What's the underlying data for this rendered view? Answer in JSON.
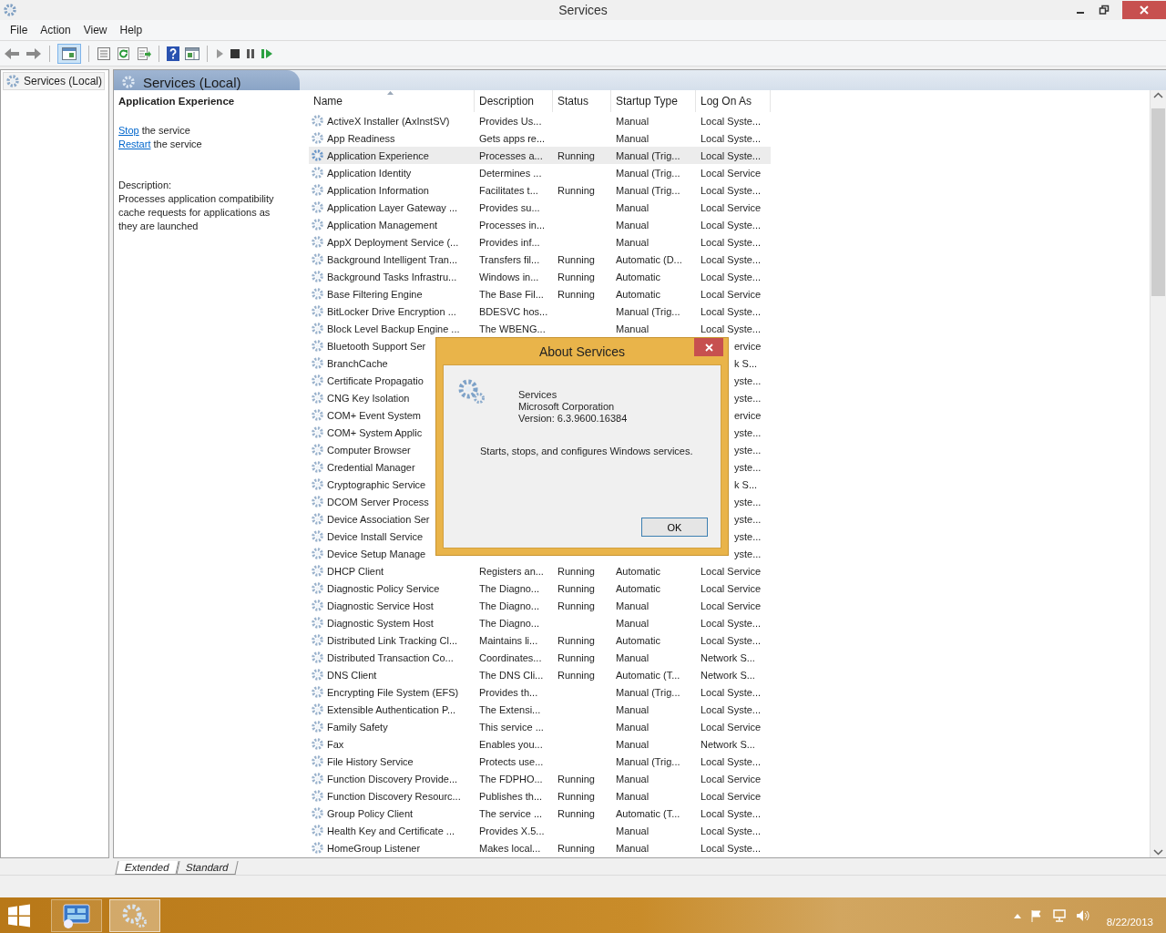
{
  "window": {
    "title": "Services"
  },
  "menu": [
    "File",
    "Action",
    "View",
    "Help"
  ],
  "tree": [
    {
      "label": "Services (Local)",
      "selected": true
    }
  ],
  "pane_header": "Services (Local)",
  "details": {
    "title": "Application Experience",
    "actions": [
      {
        "link": "Stop",
        "text": "the service"
      },
      {
        "link": "Restart",
        "text": "the service"
      }
    ],
    "description_label": "Description:",
    "description": "Processes application compatibility cache requests for applications as they are launched"
  },
  "table": {
    "columns": [
      "Name",
      "Description",
      "Status",
      "Startup Type",
      "Log On As"
    ],
    "rows": [
      {
        "kind": "service",
        "selected": false,
        "name": "ActiveX Installer (AxInstSV)",
        "description": "Provides Us...",
        "startup": "Manual",
        "logon": "Local Syste..."
      },
      {
        "kind": "service",
        "selected": false,
        "name": "App Readiness",
        "description": "Gets apps re...",
        "startup": "Manual",
        "logon": "Local Syste..."
      },
      {
        "kind": "service",
        "selected": true,
        "name": "Application Experience",
        "description": "Processes a...",
        "status": "Running",
        "startup": "Manual (Trig...",
        "logon": "Local Syste..."
      },
      {
        "kind": "service",
        "selected": false,
        "name": "Application Identity",
        "description": "Determines ...",
        "startup": "Manual (Trig...",
        "logon": "Local Service"
      },
      {
        "kind": "service",
        "selected": false,
        "name": "Application Information",
        "description": "Facilitates t...",
        "status": "Running",
        "startup": "Manual (Trig...",
        "logon": "Local Syste..."
      },
      {
        "kind": "service",
        "selected": false,
        "name": "Application Layer Gateway ...",
        "description": "Provides su...",
        "startup": "Manual",
        "logon": "Local Service"
      },
      {
        "kind": "service",
        "selected": false,
        "name": "Application Management",
        "description": "Processes in...",
        "startup": "Manual",
        "logon": "Local Syste..."
      },
      {
        "kind": "service",
        "selected": false,
        "name": "AppX Deployment Service (...",
        "description": "Provides inf...",
        "startup": "Manual",
        "logon": "Local Syste..."
      },
      {
        "kind": "service",
        "selected": false,
        "name": "Background Intelligent Tran...",
        "description": "Transfers fil...",
        "status": "Running",
        "startup": "Automatic (D...",
        "logon": "Local Syste..."
      },
      {
        "kind": "service",
        "selected": false,
        "name": "Background Tasks Infrastru...",
        "description": "Windows in...",
        "status": "Running",
        "startup": "Automatic",
        "logon": "Local Syste..."
      },
      {
        "kind": "service",
        "selected": false,
        "name": "Base Filtering Engine",
        "description": "The Base Fil...",
        "status": "Running",
        "startup": "Automatic",
        "logon": "Local Service"
      },
      {
        "kind": "service",
        "selected": false,
        "name": "BitLocker Drive Encryption ...",
        "description": "BDESVC hos...",
        "startup": "Manual (Trig...",
        "logon": "Local Syste..."
      },
      {
        "kind": "service",
        "selected": false,
        "name": "Block Level Backup Engine ...",
        "description": "The WBENG...",
        "startup": "Manual",
        "logon": "Local Syste..."
      },
      {
        "kind": "covered",
        "selected": false,
        "name": "Bluetooth Support Ser",
        "logon": "ervice"
      },
      {
        "kind": "covered",
        "selected": false,
        "name": "BranchCache",
        "logon": "k S..."
      },
      {
        "kind": "covered",
        "selected": false,
        "name": "Certificate Propagatio",
        "logon": "yste..."
      },
      {
        "kind": "covered",
        "selected": false,
        "name": "CNG Key Isolation",
        "logon": "yste..."
      },
      {
        "kind": "covered",
        "selected": false,
        "name": "COM+ Event System",
        "logon": "ervice"
      },
      {
        "kind": "covered",
        "selected": false,
        "name": "COM+ System Applic",
        "logon": "yste..."
      },
      {
        "kind": "covered",
        "selected": false,
        "name": "Computer Browser",
        "logon": "yste..."
      },
      {
        "kind": "covered",
        "selected": false,
        "name": "Credential Manager",
        "logon": "yste..."
      },
      {
        "kind": "covered",
        "selected": false,
        "name": "Cryptographic Service",
        "logon": "k S..."
      },
      {
        "kind": "covered",
        "selected": false,
        "name": "DCOM Server Process",
        "logon": "yste..."
      },
      {
        "kind": "covered",
        "selected": false,
        "name": "Device Association Ser",
        "logon": "yste..."
      },
      {
        "kind": "covered",
        "selected": false,
        "name": "Device Install Service",
        "logon": "yste..."
      },
      {
        "kind": "covered",
        "selected": false,
        "name": "Device Setup Manage",
        "logon": "yste..."
      },
      {
        "kind": "service",
        "selected": false,
        "name": "DHCP Client",
        "description": "Registers an...",
        "status": "Running",
        "startup": "Automatic",
        "logon": "Local Service"
      },
      {
        "kind": "service",
        "selected": false,
        "name": "Diagnostic Policy Service",
        "description": "The Diagno...",
        "status": "Running",
        "startup": "Automatic",
        "logon": "Local Service"
      },
      {
        "kind": "service",
        "selected": false,
        "name": "Diagnostic Service Host",
        "description": "The Diagno...",
        "status": "Running",
        "startup": "Manual",
        "logon": "Local Service"
      },
      {
        "kind": "service",
        "selected": false,
        "name": "Diagnostic System Host",
        "description": "The Diagno...",
        "startup": "Manual",
        "logon": "Local Syste..."
      },
      {
        "kind": "service",
        "selected": false,
        "name": "Distributed Link Tracking Cl...",
        "description": "Maintains li...",
        "status": "Running",
        "startup": "Automatic",
        "logon": "Local Syste..."
      },
      {
        "kind": "service",
        "selected": false,
        "name": "Distributed Transaction Co...",
        "description": "Coordinates...",
        "status": "Running",
        "startup": "Manual",
        "logon": "Network S..."
      },
      {
        "kind": "service",
        "selected": false,
        "name": "DNS Client",
        "description": "The DNS Cli...",
        "status": "Running",
        "startup": "Automatic (T...",
        "logon": "Network S..."
      },
      {
        "kind": "service",
        "selected": false,
        "name": "Encrypting File System (EFS)",
        "description": "Provides th...",
        "startup": "Manual (Trig...",
        "logon": "Local Syste..."
      },
      {
        "kind": "service",
        "selected": false,
        "name": "Extensible Authentication P...",
        "description": "The Extensi...",
        "startup": "Manual",
        "logon": "Local Syste..."
      },
      {
        "kind": "service",
        "selected": false,
        "name": "Family Safety",
        "description": "This service ...",
        "startup": "Manual",
        "logon": "Local Service"
      },
      {
        "kind": "service",
        "selected": false,
        "name": "Fax",
        "description": "Enables you...",
        "startup": "Manual",
        "logon": "Network S..."
      },
      {
        "kind": "service",
        "selected": false,
        "name": "File History Service",
        "description": "Protects use...",
        "startup": "Manual (Trig...",
        "logon": "Local Syste..."
      },
      {
        "kind": "service",
        "selected": false,
        "name": "Function Discovery Provide...",
        "description": "The FDPHO...",
        "status": "Running",
        "startup": "Manual",
        "logon": "Local Service"
      },
      {
        "kind": "service",
        "selected": false,
        "name": "Function Discovery Resourc...",
        "description": "Publishes th...",
        "status": "Running",
        "startup": "Manual",
        "logon": "Local Service"
      },
      {
        "kind": "service",
        "selected": false,
        "name": "Group Policy Client",
        "description": "The service ...",
        "status": "Running",
        "startup": "Automatic (T...",
        "logon": "Local Syste..."
      },
      {
        "kind": "service",
        "selected": false,
        "name": "Health Key and Certificate ...",
        "description": "Provides X.5...",
        "startup": "Manual",
        "logon": "Local Syste..."
      },
      {
        "kind": "service",
        "selected": false,
        "name": "HomeGroup Listener",
        "description": "Makes local...",
        "status": "Running",
        "startup": "Manual",
        "logon": "Local Syste..."
      }
    ]
  },
  "tabs": [
    {
      "label": "Extended",
      "selected": true
    },
    {
      "label": "Standard",
      "selected": false
    }
  ],
  "dialog": {
    "title": "About Services",
    "product": "Services",
    "company": "Microsoft Corporation",
    "version": "Version: 6.3.9600.16384",
    "text": "Starts, stops, and configures Windows services.",
    "button": "OK"
  },
  "taskbar": {
    "apps": [
      {
        "kind": "server-manager",
        "active": false
      },
      {
        "kind": "services",
        "active": true
      }
    ],
    "date": "8/22/2013"
  }
}
